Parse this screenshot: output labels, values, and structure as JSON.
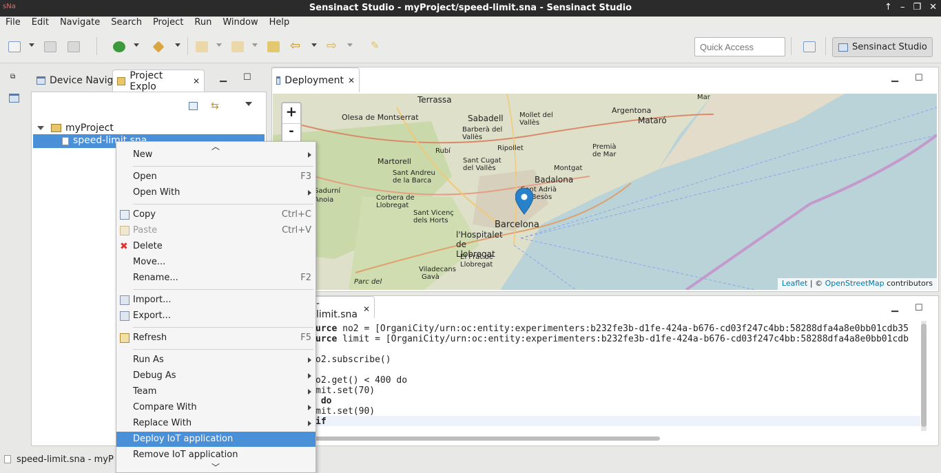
{
  "window": {
    "title": "Sensinact Studio - myProject/speed-limit.sna - Sensinact Studio",
    "logo": "sNa"
  },
  "menubar": [
    "File",
    "Edit",
    "Navigate",
    "Search",
    "Project",
    "Run",
    "Window",
    "Help"
  ],
  "toolbar": {
    "quick_access_placeholder": "Quick Access",
    "perspective_label": "Sensinact Studio"
  },
  "left_panel": {
    "tabs": [
      {
        "label": "Device Navig"
      },
      {
        "label": "Project Explo"
      }
    ],
    "tree": {
      "project": "myProject",
      "file": "speed-limit.sna"
    }
  },
  "deployment": {
    "tab_label": "Deployment",
    "zoom_in": "+",
    "zoom_out": "-",
    "attribution": {
      "leaflet": "Leaflet",
      "sep": " | © ",
      "osm": "OpenStreetMap",
      "suffix": " contributors"
    },
    "places": [
      {
        "name": "Terrassa"
      },
      {
        "name": "Sabadell"
      },
      {
        "name": "Olesa de Montserrat"
      },
      {
        "name": "Barberà del Vallès"
      },
      {
        "name": "Mollet del Vallès"
      },
      {
        "name": "Argentona"
      },
      {
        "name": "Mataró"
      },
      {
        "name": "Rubí"
      },
      {
        "name": "Ripollet"
      },
      {
        "name": "Martorell"
      },
      {
        "name": "Sant Cugat del Vallès"
      },
      {
        "name": "Montgat"
      },
      {
        "name": "Premià de Mar"
      },
      {
        "name": "Sant Andreu de la Barca"
      },
      {
        "name": "Badalona"
      },
      {
        "name": "Sant Adrià de Besòs"
      },
      {
        "name": "Corbera de Llobregat"
      },
      {
        "name": "Barcelona"
      },
      {
        "name": "Sant Vicenç dels Horts"
      },
      {
        "name": "l'Hospitalet de Llobregat"
      },
      {
        "name": "El Prat de Llobregat"
      },
      {
        "name": "Viladecans"
      },
      {
        "name": "Gavà"
      },
      {
        "name": "Parc del"
      },
      {
        "name": "Sadurní"
      },
      {
        "name": "Anoia"
      },
      {
        "name": "Mar"
      }
    ]
  },
  "editor": {
    "tab_label": "-limit.sna",
    "lines": [
      {
        "kw": "urce",
        "text": " no2 = [OrganiCity/urn:oc:entity:experimenters:b232fe3b-d1fe-424a-b676-cd03f247c4bb:58288dfa4a8e0bb01cdb35"
      },
      {
        "kw": "urce",
        "text": " limit = [OrganiCity/urn:oc:entity:experimenters:b232fe3b-d1fe-424a-b676-cd03f247c4bb:58288dfa4a8e0bb01cdb"
      },
      {
        "kw": "",
        "text": "o2.subscribe()"
      },
      {
        "kw": "",
        "text": "o2.get() < 400 do"
      },
      {
        "kw": "",
        "text": "mit.set(70)"
      },
      {
        "kw": "",
        "text": " do"
      },
      {
        "kw": "",
        "text": "mit.set(90)"
      },
      {
        "kw": "",
        "text": "if"
      }
    ]
  },
  "statusbar": {
    "text": "speed-limit.sna - myP"
  },
  "context_menu": {
    "items": [
      {
        "label": "New",
        "shortcut": "",
        "submenu": true
      },
      {
        "label": "Open",
        "shortcut": "F3"
      },
      {
        "label": "Open With",
        "shortcut": "",
        "submenu": true
      },
      {
        "label": "Copy",
        "shortcut": "Ctrl+C",
        "icon": "copy-icon"
      },
      {
        "label": "Paste",
        "shortcut": "Ctrl+V",
        "icon": "paste-icon",
        "disabled": true
      },
      {
        "label": "Delete",
        "shortcut": "",
        "icon": "delete-icon"
      },
      {
        "label": "Move...",
        "shortcut": ""
      },
      {
        "label": "Rename...",
        "shortcut": "F2"
      },
      {
        "label": "Import...",
        "shortcut": "",
        "icon": "import-icon"
      },
      {
        "label": "Export...",
        "shortcut": "",
        "icon": "export-icon"
      },
      {
        "label": "Refresh",
        "shortcut": "F5",
        "icon": "refresh-icon"
      },
      {
        "label": "Run As",
        "shortcut": "",
        "submenu": true
      },
      {
        "label": "Debug As",
        "shortcut": "",
        "submenu": true
      },
      {
        "label": "Team",
        "shortcut": "",
        "submenu": true
      },
      {
        "label": "Compare With",
        "shortcut": "",
        "submenu": true
      },
      {
        "label": "Replace With",
        "shortcut": "",
        "submenu": true
      },
      {
        "label": "Deploy IoT application",
        "shortcut": "",
        "highlighted": true
      },
      {
        "label": "Remove IoT application",
        "shortcut": ""
      }
    ]
  },
  "colors": {
    "selection": "#4a90d9",
    "titlebar": "#2b2b2b",
    "map_water": "#b9d3d9",
    "map_land": "#e4dccb"
  }
}
